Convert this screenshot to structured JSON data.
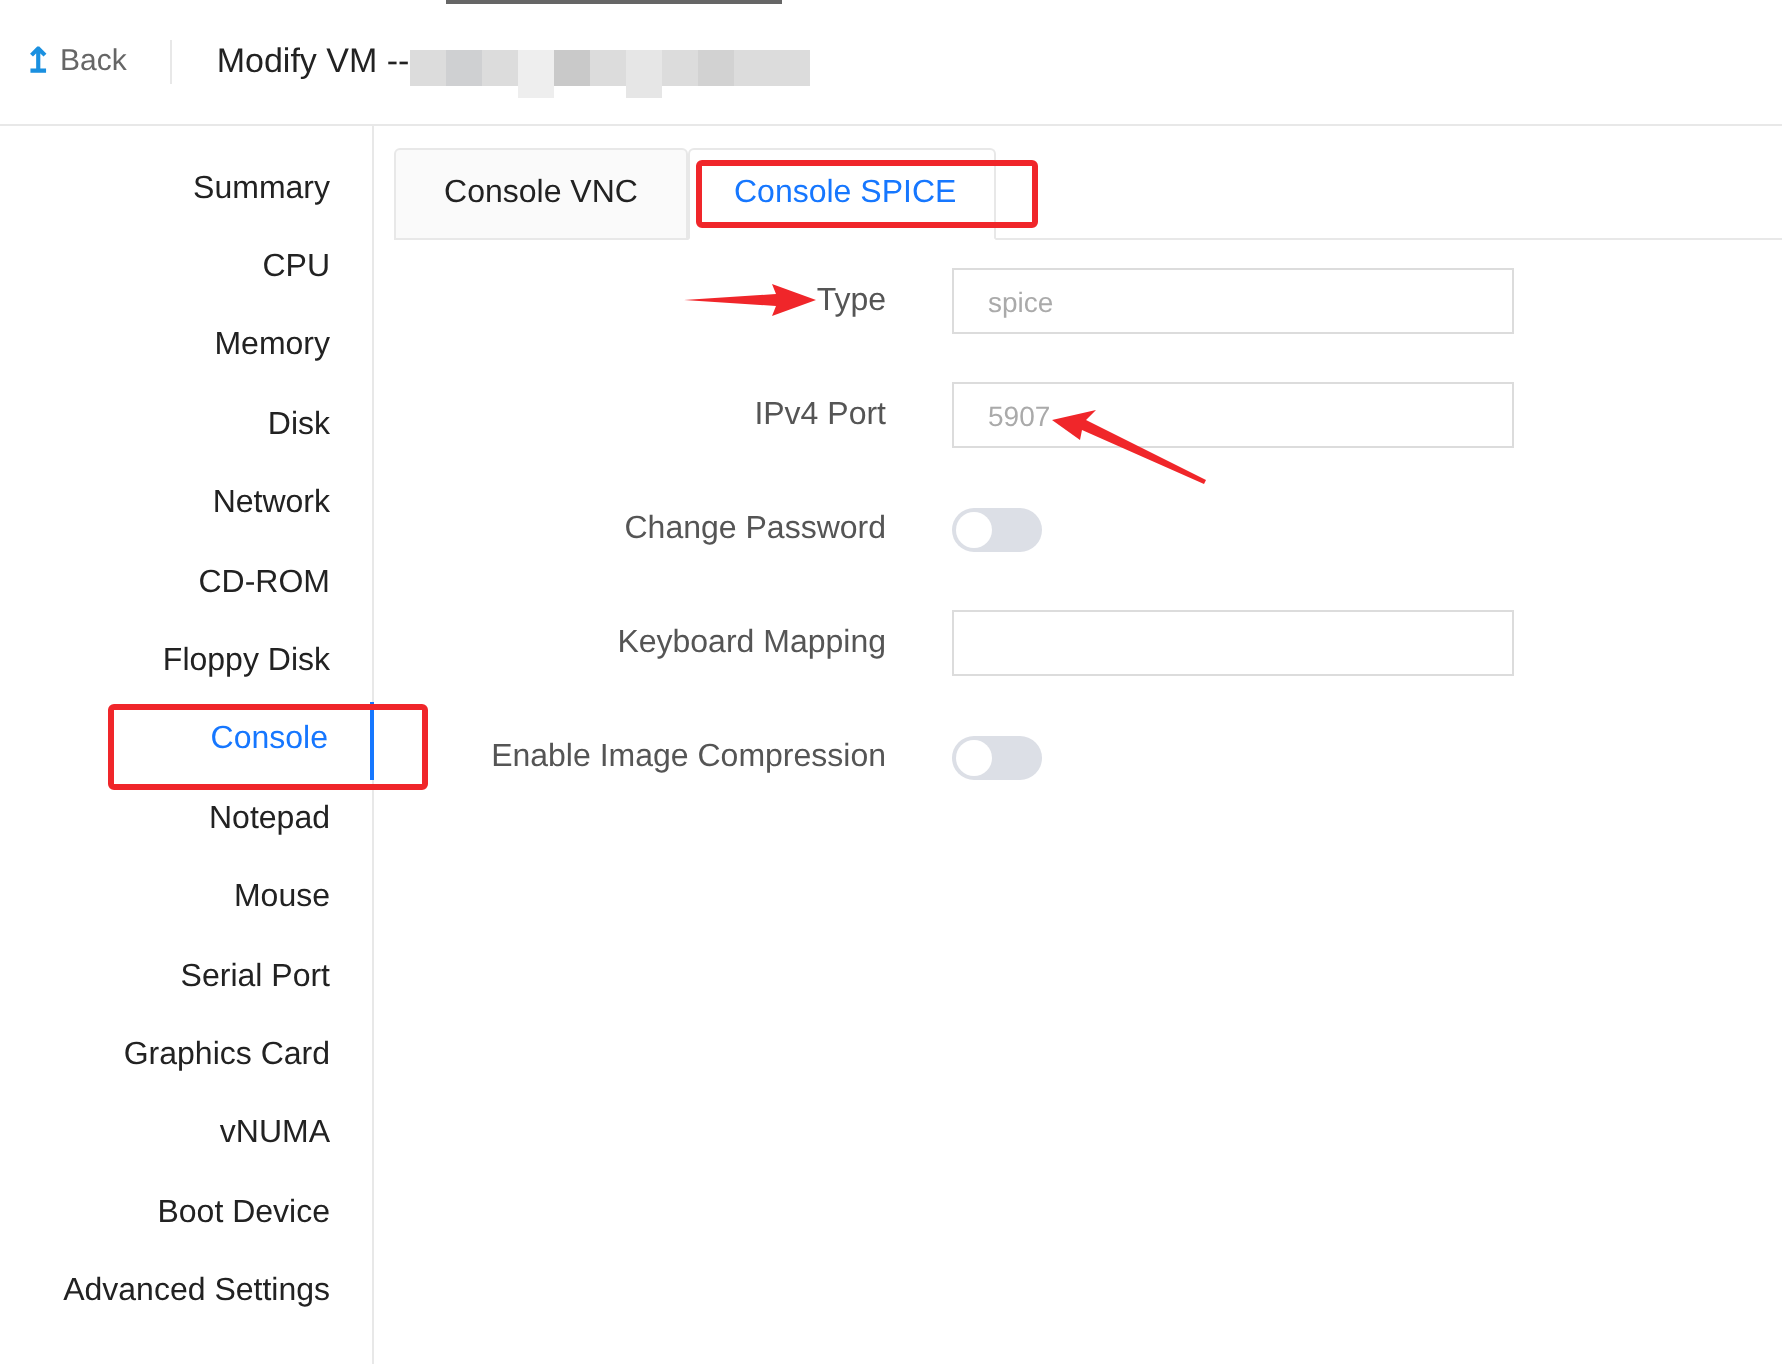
{
  "header": {
    "back": {
      "icon": "↥",
      "label": "Back"
    },
    "title": "Modify VM --"
  },
  "sidebar": {
    "items": [
      {
        "label": "Summary",
        "selected": false
      },
      {
        "label": "CPU",
        "selected": false
      },
      {
        "label": "Memory",
        "selected": false
      },
      {
        "label": "Disk",
        "selected": false
      },
      {
        "label": "Network",
        "selected": false
      },
      {
        "label": "CD-ROM",
        "selected": false
      },
      {
        "label": "Floppy Disk",
        "selected": false
      },
      {
        "label": "Console",
        "selected": true
      },
      {
        "label": "Notepad",
        "selected": false
      },
      {
        "label": "Mouse",
        "selected": false
      },
      {
        "label": "Serial Port",
        "selected": false
      },
      {
        "label": "Graphics Card",
        "selected": false
      },
      {
        "label": "vNUMA",
        "selected": false
      },
      {
        "label": "Boot Device",
        "selected": false
      },
      {
        "label": "Advanced Settings",
        "selected": false
      }
    ]
  },
  "tabs": [
    {
      "label": "Console VNC",
      "selected": false
    },
    {
      "label": "Console SPICE",
      "selected": true
    }
  ],
  "form": [
    {
      "kind": "input",
      "label": "Type",
      "value": "spice",
      "disabled": true
    },
    {
      "kind": "input",
      "label": "IPv4 Port",
      "value": "5907",
      "disabled": true
    },
    {
      "kind": "switch",
      "label": "Change Password",
      "on": false
    },
    {
      "kind": "input",
      "label": "Keyboard Mapping"
    },
    {
      "kind": "switch",
      "label": "Enable Image Compression",
      "on": false
    }
  ]
}
